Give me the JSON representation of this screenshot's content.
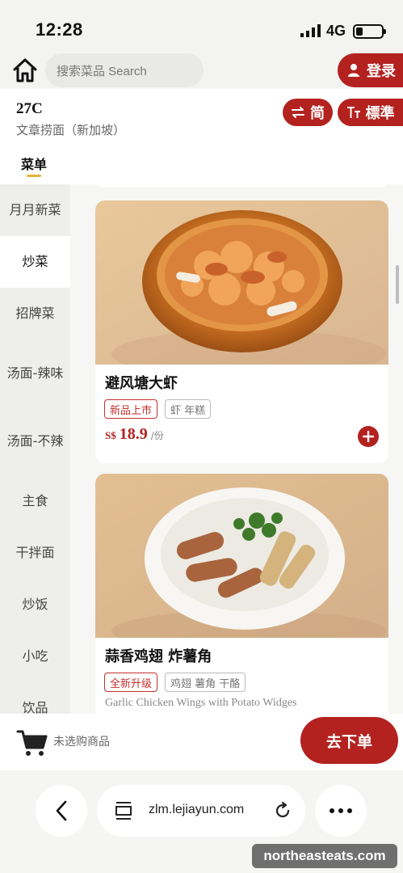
{
  "status_bar": {
    "time": "12:28",
    "network": "4G"
  },
  "topbar": {
    "search_placeholder": "搜索菜品 Search",
    "login_label": "登录"
  },
  "store": {
    "table_no": "27C",
    "name": "文章捞面（新加坡）",
    "lang_toggle_label": "简",
    "text_size_label": "標準",
    "tab_menu_label": "菜单"
  },
  "sidebar": {
    "categories": [
      "月月新菜",
      "炒菜",
      "招牌菜",
      "汤面-辣味",
      "汤面-不辣",
      "主食",
      "干拌面",
      "炒饭",
      "小吃",
      "饮品"
    ],
    "active": "炒菜"
  },
  "items": [
    {
      "name": "避风塘大虾",
      "tag_primary": "新品上市",
      "tag_secondary": "虾 年糕",
      "currency": "S$",
      "price": "18.9",
      "unit": "/份"
    },
    {
      "name": "蒜香鸡翅 炸薯角",
      "tag_primary": "全新升级",
      "tag_secondary": "鸡翅 薯角 干酪",
      "subtitle_en": "Garlic Chicken Wings with Potato Widges"
    }
  ],
  "cart": {
    "empty_text": "未选购商品",
    "checkout_label": "去下单"
  },
  "browser": {
    "url": "zlm.lejiayun.com",
    "watermark": "northeasteats.com"
  },
  "colors": {
    "brand_red": "#b3221f",
    "accent_yellow": "#e8b23a"
  },
  "icons": [
    "home-icon",
    "user-icon",
    "swap-icon",
    "text-size-icon",
    "plus-icon",
    "cart-icon",
    "back-icon",
    "tabs-icon",
    "reload-icon",
    "more-icon"
  ]
}
